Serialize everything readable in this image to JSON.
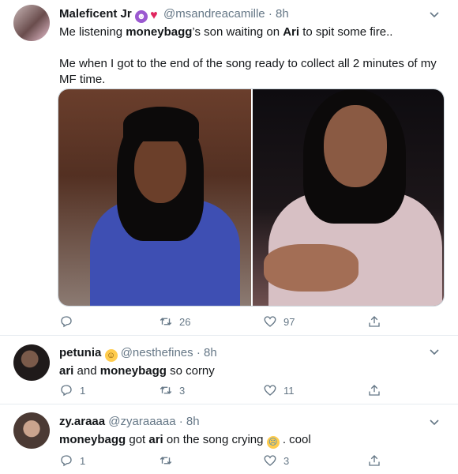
{
  "tweets": [
    {
      "name": "Maleficent Jr",
      "handle": "@msandreacamille",
      "time": "8h",
      "line1_pre": "Me listening ",
      "line1_b1": "moneybagg",
      "line1_mid": "’s son waiting on ",
      "line1_b2": "Ari",
      "line1_post": " to spit some fire..",
      "line2": "Me when I got to the end of the song ready to collect all 2 minutes of my MF time.",
      "replies": "",
      "retweets": "26",
      "likes": "97"
    },
    {
      "name": "petunia",
      "handle": "@nesthefines",
      "time": "8h",
      "b1": "ari",
      "mid": " and ",
      "b2": "moneybagg",
      "post": " so corny",
      "replies": "1",
      "retweets": "3",
      "likes": "11"
    },
    {
      "name": "zy.araaa",
      "handle": "@zyaraaaaa",
      "time": "8h",
      "b1": "moneybagg",
      "mid": " got ",
      "b2": "ari",
      "post": " on the song crying",
      "tail": " . cool",
      "replies": "1",
      "retweets": "",
      "likes": "3"
    }
  ],
  "dot": "·",
  "icons": {
    "reply": "reply-icon",
    "retweet": "retweet-icon",
    "like": "heart-icon",
    "share": "share-icon",
    "caret": "chevron-down-icon"
  },
  "colors": {
    "text": "#14171a",
    "muted": "#657786",
    "border": "#e6ecf0"
  }
}
